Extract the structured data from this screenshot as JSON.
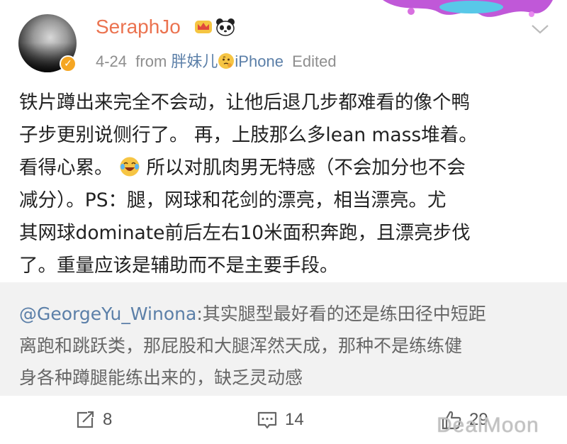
{
  "post": {
    "author": {
      "name": "SeraphJo",
      "verified": true
    },
    "meta": {
      "date": "4-24",
      "from_label": "from",
      "source": "胖妹儿",
      "device": "iPhone",
      "edited": "Edited"
    },
    "body_lines": [
      "铁片蹲出来完全不会动，让他后退几步都难看的像个鸭",
      "子步更别说侧行了。 再，上肢那么多lean mass堆着。",
      "看得心累。",
      " 所以对肌肉男无特感（不会加分也不会",
      "减分）。PS：腿，网球和花剑的漂亮，相当漂亮。尤",
      "其网球dominate前后左右10米面积奔跑，且漂亮步伐",
      "了。重量应该是辅助而不是主要手段。"
    ]
  },
  "quote": {
    "mention": "@GeorgeYu_Winona",
    "line1_rest": ":其实腿型最好看的还是练田径中短距",
    "line2": "离跑和跳跃类，那屁股和大腿浑然天成，那种不是练练健",
    "line3": "身各种蹲腿能练出来的，缺乏灵动感"
  },
  "actions": {
    "repost_count": "8",
    "comment_count": "14",
    "like_count": "29"
  },
  "watermark": "DealMoon",
  "icons": [
    "avatar",
    "verified-badge-icon",
    "crown-icon",
    "panda-icon",
    "chevron-down-icon",
    "thinking-face-icon",
    "laughing-crying-icon",
    "repost-icon",
    "comment-icon",
    "thumbs-up-icon"
  ],
  "colors": {
    "username": "#eb7350",
    "link": "#5b7fa8",
    "meta": "#8e8e8e",
    "quote_bg": "#f2f2f2"
  }
}
